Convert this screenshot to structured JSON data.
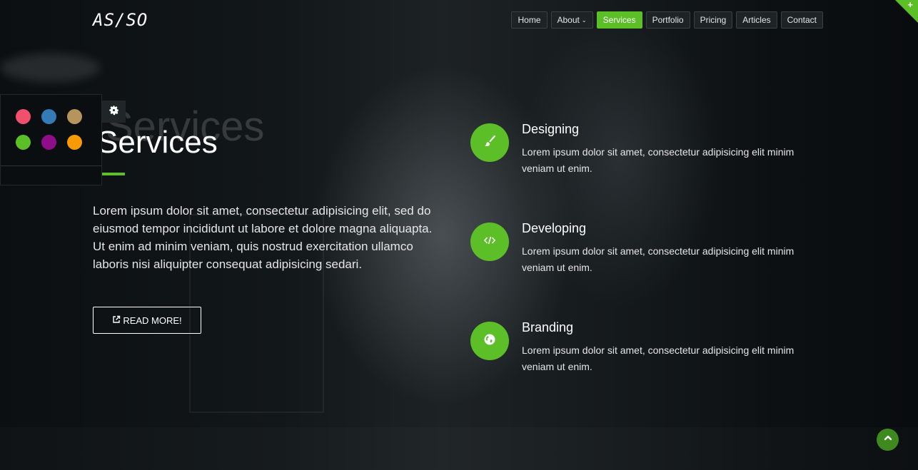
{
  "brand": {
    "logo": "AS/SO"
  },
  "nav": {
    "items": [
      {
        "label": "Home"
      },
      {
        "label": "About"
      },
      {
        "label": "Services"
      },
      {
        "label": "Portfolio"
      },
      {
        "label": "Pricing"
      },
      {
        "label": "Articles"
      },
      {
        "label": "Contact"
      }
    ],
    "active": "Services",
    "about_chevron": "⌄"
  },
  "corner": {
    "plus": "+"
  },
  "hero": {
    "ghost_title": "Services",
    "title": "Services",
    "intro": "Lorem ipsum dolor sit amet, consectetur adipisicing elit, sed do eiusmod tempor incididunt ut labore et dolore magna aliquapta. Ut enim ad minim veniam, quis nostrud exercitation ullamco laboris nisi aliquipter consequat adipisicing sedari.",
    "read_more": "READ MORE!",
    "read_more_icon": "external-link-icon"
  },
  "style_switcher": {
    "gear_icon": "gear-icon",
    "colors": [
      "#f0506e",
      "#337ab7",
      "#b5955c",
      "#5cbf28",
      "#8e0e8a",
      "#f89a06"
    ]
  },
  "services": [
    {
      "title": "Designing",
      "desc": "Lorem ipsum dolor sit amet, consectetur adipisicing elit minim veniam ut enim.",
      "icon": "paint-brush-icon"
    },
    {
      "title": "Developing",
      "desc": "Lorem ipsum dolor sit amet, consectetur adipisicing elit minim veniam ut enim.",
      "icon": "code-icon"
    },
    {
      "title": "Branding",
      "desc": "Lorem ipsum dolor sit amet, consectetur adipisicing elit minim veniam ut enim.",
      "icon": "globe-icon"
    }
  ],
  "colors": {
    "accent": "#5cbf28",
    "background": "#0d1113"
  },
  "scroll_top": {
    "icon": "chevron-up-icon"
  }
}
